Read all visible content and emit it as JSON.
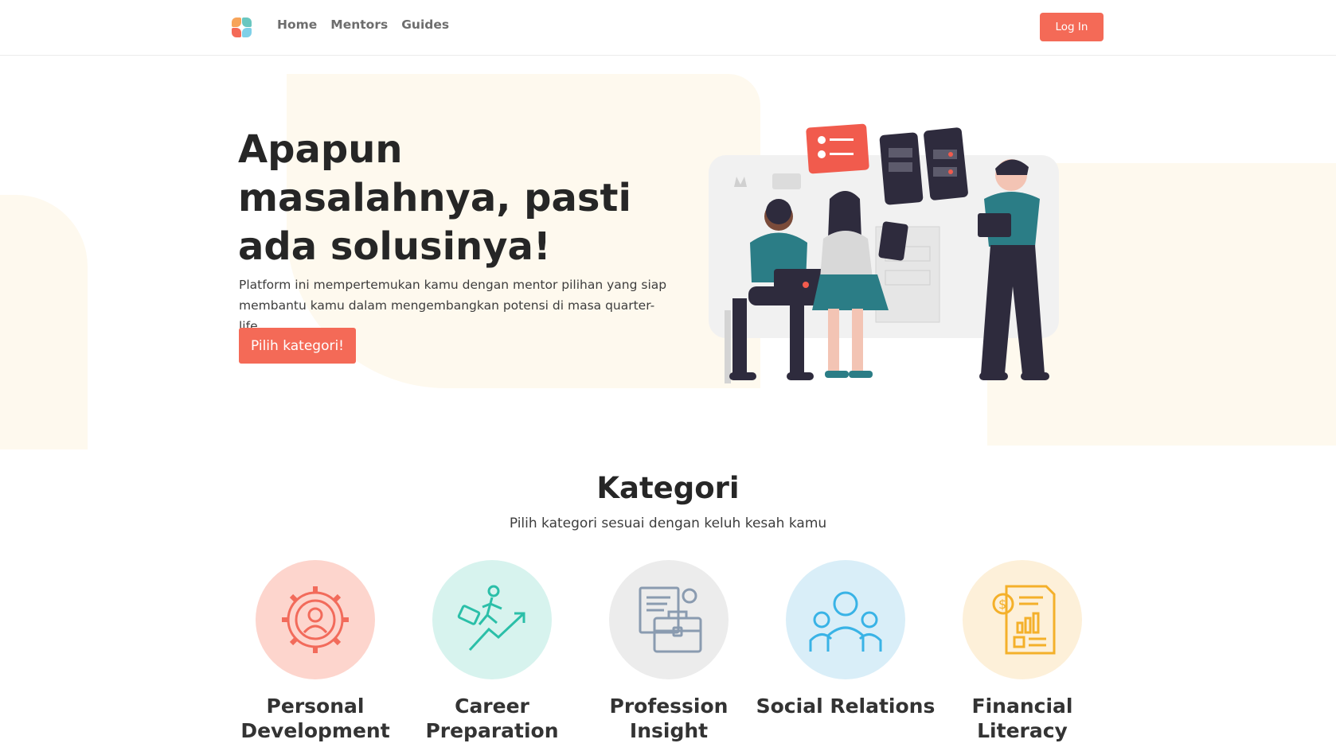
{
  "nav": {
    "links": [
      "Home",
      "Mentors",
      "Guides"
    ],
    "login_label": "Log In"
  },
  "hero": {
    "title": "Apapun masalahnya, pasti ada solusinya!",
    "subtitle": "Platform ini mempertemukan kamu dengan mentor pilihan yang siap membantu kamu dalam mengembangkan potensi di masa quarter-life",
    "cta_label": "Pilih kategori!"
  },
  "categories_section": {
    "title": "Kategori",
    "subtitle": "Pilih kategori sesuai dengan keluh kesah kamu",
    "items": [
      {
        "label": "Personal Development",
        "icon": "person-gear-icon",
        "bg": "#fdd5cd",
        "fg": "#f26b5b"
      },
      {
        "label": "Career Preparation",
        "icon": "career-climb-icon",
        "bg": "#d7f3ee",
        "fg": "#2bbfa8"
      },
      {
        "label": "Profession Insight",
        "icon": "briefcase-document-icon",
        "bg": "#ececec",
        "fg": "#8a9bb0"
      },
      {
        "label": "Social Relations",
        "icon": "people-group-icon",
        "bg": "#d9eef8",
        "fg": "#39b3e6"
      },
      {
        "label": "Financial Literacy",
        "icon": "finance-report-icon",
        "bg": "#fdf0d9",
        "fg": "#f4b02a"
      }
    ]
  },
  "colors": {
    "accent": "#f46a57",
    "blob": "#fef9ee"
  }
}
